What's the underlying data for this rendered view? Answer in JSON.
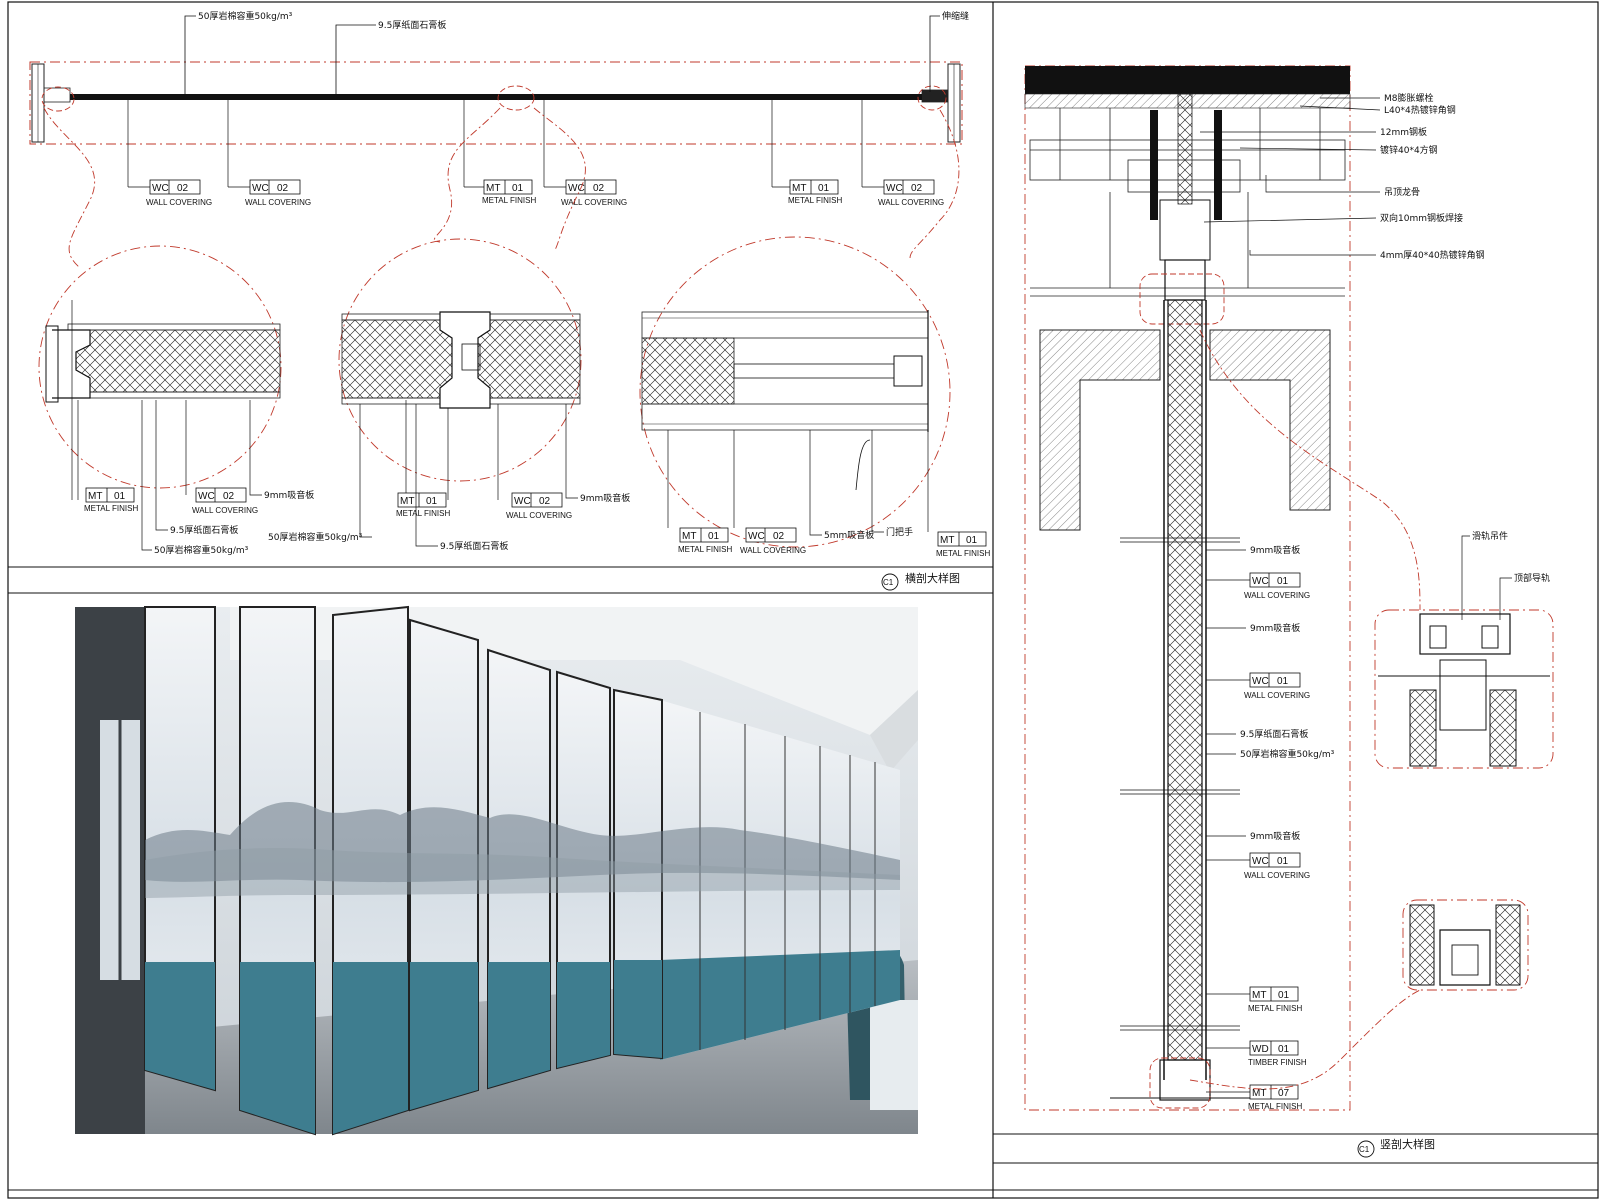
{
  "drawing": {
    "plan_title": "横剖大样图",
    "plan_code": "C1",
    "section_title": "竖剖大样图",
    "section_code": "C1"
  },
  "plan_notes": {
    "note_a": "50厚岩棉容重50kg/m³",
    "note_b": "9.5厚纸面石膏板",
    "note_c": "伸缩缝",
    "note_d": "9mm吸音板",
    "note_e": "50厚岩棉容重50kg/m³",
    "note_f": "9.5厚纸面石膏板",
    "note_g": "9mm吸音板",
    "note_h": "50厚岩棉容重50kg/m³",
    "note_i": "5mm吸音板",
    "note_j": "门把手"
  },
  "section_notes": {
    "n1": "M8膨胀螺栓",
    "n2": "L40*4热镀锌角钢",
    "n3": "12mm钢板",
    "n4": "镀锌40*4方钢",
    "n5": "吊顶龙骨",
    "n6": "双向10mm钢板焊接",
    "n7": "4mm厚40*40热镀锌角钢",
    "n8": "9mm吸音板",
    "n9": "9mm吸音板",
    "n10": "9.5厚纸面石膏板",
    "n11": "50厚岩棉容重50kg/m³",
    "n12": "9mm吸音板",
    "n13": "滑轨吊件",
    "n14": "顶部导轨"
  },
  "tags": {
    "wc": "WC",
    "mt": "MT",
    "wd": "WD",
    "n01": "01",
    "n02": "02",
    "n07": "07",
    "wall_covering": "WALL COVERING",
    "metal_finish": "METAL FINISH",
    "timber_finish": "TIMBER FINISH"
  },
  "colors": {
    "redline": "#c0392b",
    "ink": "#111111",
    "panel_teal": "#3e7d8f",
    "panel_mist": "#dfe6ec",
    "floor": "#9aa1a8"
  }
}
